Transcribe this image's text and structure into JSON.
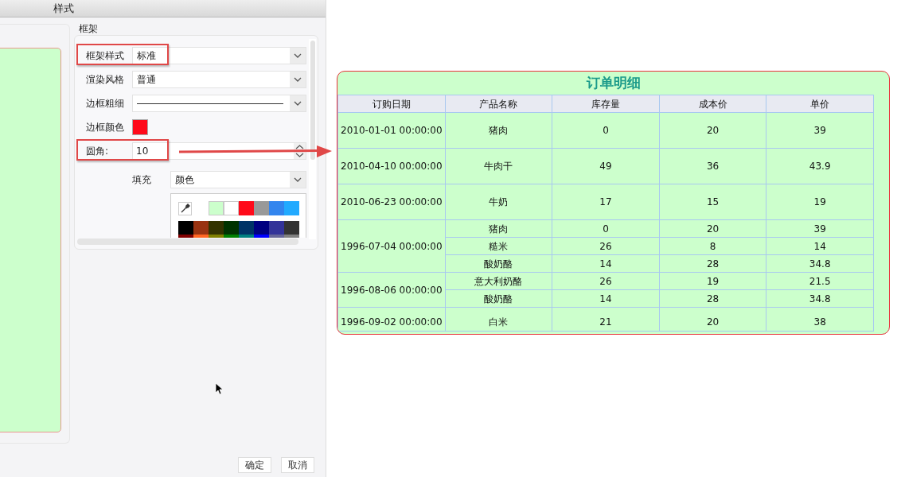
{
  "dialog": {
    "title": "样式",
    "frame_group": {
      "title": "框架",
      "rows": [
        {
          "kind": "select",
          "label": "框架样式",
          "value": "标准",
          "highlighted": true
        },
        {
          "kind": "select",
          "label": "渲染风格",
          "value": "普通",
          "highlighted": false
        },
        {
          "kind": "line",
          "label": "边框粗细",
          "highlighted": false
        },
        {
          "kind": "color",
          "label": "边框颜色",
          "color": "#ff0a1a",
          "highlighted": false
        },
        {
          "kind": "spin",
          "label": "圆角:",
          "value": "10",
          "highlighted": true
        }
      ],
      "fill": {
        "label": "填充",
        "value": "颜色"
      },
      "palette": {
        "recent": [
          {
            "color": "#ccffcc"
          },
          {
            "color": "#ffffff"
          },
          {
            "color": "#ff0a1a"
          },
          {
            "color": "#999999"
          },
          {
            "color": "#3385ee"
          },
          {
            "color": "#22aaff"
          }
        ],
        "grid": [
          {
            "color": "#000000"
          },
          {
            "color": "#993311"
          },
          {
            "color": "#333300"
          },
          {
            "color": "#003300"
          },
          {
            "color": "#003366"
          },
          {
            "color": "#000080"
          },
          {
            "color": "#333399"
          },
          {
            "color": "#333333"
          },
          {
            "color": "#800000"
          },
          {
            "color": "#ff6622"
          },
          {
            "color": "#808000"
          },
          {
            "color": "#008000"
          },
          {
            "color": "#008080"
          },
          {
            "color": "#0000ff"
          },
          {
            "color": "#666699"
          },
          {
            "color": "#808080"
          }
        ]
      }
    },
    "buttons": [
      "确定",
      "取消"
    ]
  },
  "table": {
    "title": "订单明细",
    "columns": [
      "订购日期",
      "产品名称",
      "库存量",
      "成本价",
      "单价"
    ],
    "groups": [
      {
        "date": "2010-01-01 00:00:00",
        "items": [
          {
            "product": "猪肉",
            "stock": "0",
            "cost": "20",
            "price": "39"
          }
        ]
      },
      {
        "date": "2010-04-10 00:00:00",
        "items": [
          {
            "product": "牛肉干",
            "stock": "49",
            "cost": "36",
            "price": "43.9"
          }
        ]
      },
      {
        "date": "2010-06-23 00:00:00",
        "items": [
          {
            "product": "牛奶",
            "stock": "17",
            "cost": "15",
            "price": "19"
          }
        ]
      },
      {
        "date": "1996-07-04 00:00:00",
        "items": [
          {
            "product": "猪肉",
            "stock": "0",
            "cost": "20",
            "price": "39"
          },
          {
            "product": "糙米",
            "stock": "26",
            "cost": "8",
            "price": "14"
          },
          {
            "product": "酸奶酪",
            "stock": "14",
            "cost": "28",
            "price": "34.8"
          }
        ]
      },
      {
        "date": "1996-08-06 00:00:00",
        "items": [
          {
            "product": "意大利奶酪",
            "stock": "26",
            "cost": "19",
            "price": "21.5"
          },
          {
            "product": "酸奶酪",
            "stock": "14",
            "cost": "28",
            "price": "34.8"
          }
        ]
      },
      {
        "date": "1996-09-02 00:00:00",
        "items": [
          {
            "product": "白米",
            "stock": "21",
            "cost": "20",
            "price": "38"
          }
        ]
      }
    ]
  }
}
